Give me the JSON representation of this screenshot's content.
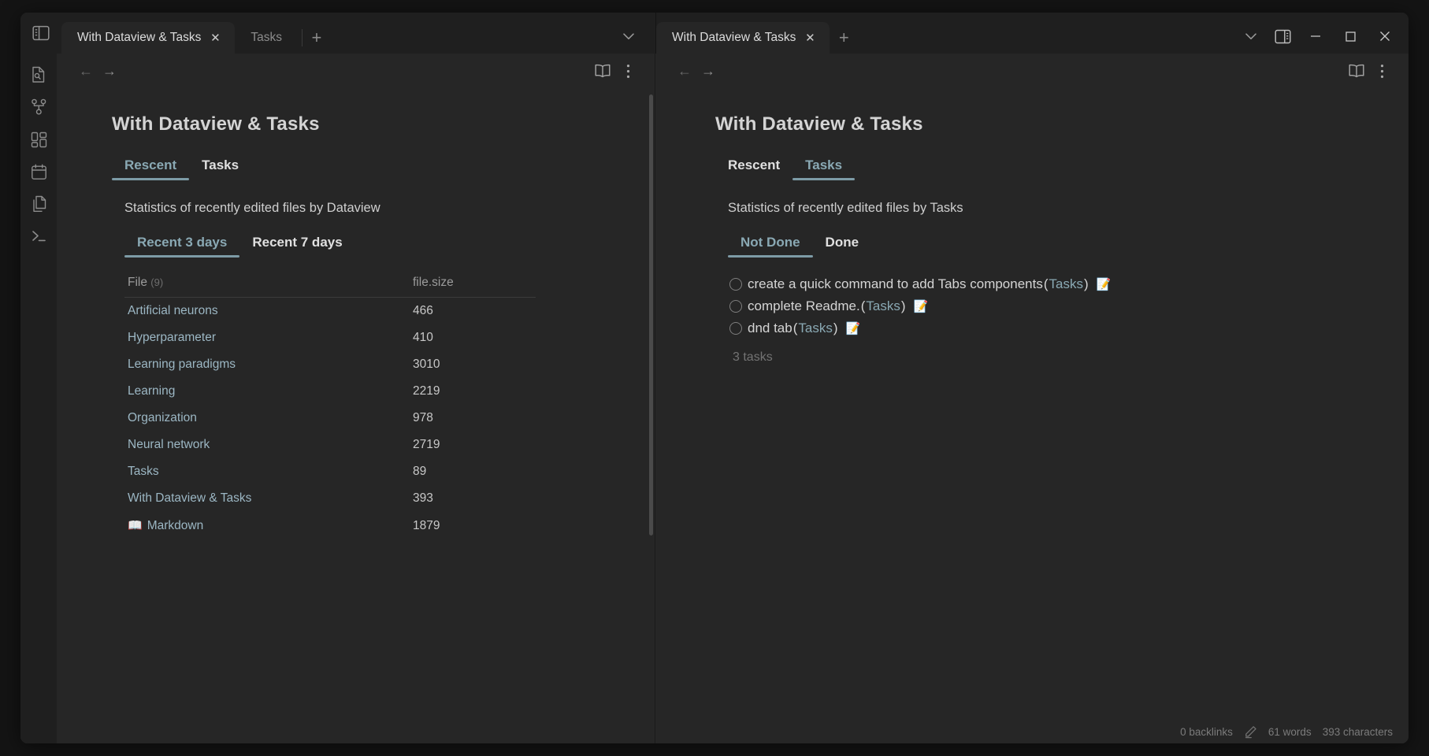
{
  "window": {
    "left_tabs": [
      {
        "label": "With Dataview & Tasks",
        "active": true,
        "close": "✕"
      },
      {
        "label": "Tasks",
        "active": false,
        "close": ""
      }
    ],
    "right_tabs": [
      {
        "label": "With Dataview & Tasks",
        "active": true,
        "close": "✕"
      }
    ],
    "new_tab_label": "+",
    "controls": {
      "minimize": "–",
      "maximize": "☐",
      "close": "✕",
      "chevron_down": "∨"
    }
  },
  "ribbon": {
    "items": [
      {
        "name": "file-search-icon"
      },
      {
        "name": "graph-view-icon"
      },
      {
        "name": "canvas-icon"
      },
      {
        "name": "calendar-icon"
      },
      {
        "name": "files-icon"
      },
      {
        "name": "terminal-icon"
      }
    ]
  },
  "left_pane": {
    "nav": {
      "back": "←",
      "forward": "→"
    },
    "title": "With Dataview & Tasks",
    "note_tabs": [
      {
        "label": "Rescent",
        "active": true
      },
      {
        "label": "Tasks",
        "active": false
      }
    ],
    "paragraph": "Statistics of recently edited files by Dataview",
    "sub_tabs": [
      {
        "label": "Recent 3 days",
        "active": true
      },
      {
        "label": "Recent 7 days",
        "active": false
      }
    ],
    "table": {
      "headers": {
        "file": "File",
        "count": "(9)",
        "size": "file.size"
      },
      "rows": [
        {
          "emoji": "",
          "file": "Artificial neurons",
          "size": "466"
        },
        {
          "emoji": "",
          "file": "Hyperparameter",
          "size": "410"
        },
        {
          "emoji": "",
          "file": "Learning paradigms",
          "size": "3010"
        },
        {
          "emoji": "",
          "file": "Learning",
          "size": "2219"
        },
        {
          "emoji": "",
          "file": "Organization",
          "size": "978"
        },
        {
          "emoji": "",
          "file": "Neural network",
          "size": "2719"
        },
        {
          "emoji": "",
          "file": "Tasks",
          "size": "89"
        },
        {
          "emoji": "",
          "file": "With Dataview & Tasks",
          "size": "393"
        },
        {
          "emoji": "📖",
          "file": "Markdown",
          "size": "1879"
        }
      ]
    }
  },
  "right_pane": {
    "nav": {
      "back": "←",
      "forward": "→"
    },
    "title": "With Dataview & Tasks",
    "note_tabs": [
      {
        "label": "Rescent",
        "active": false
      },
      {
        "label": "Tasks",
        "active": true
      }
    ],
    "paragraph": "Statistics of recently edited files by Tasks",
    "sub_tabs": [
      {
        "label": "Not Done",
        "active": true
      },
      {
        "label": "Done",
        "active": false
      }
    ],
    "tasks": [
      {
        "text": "create a quick command to add Tabs components ",
        "open_paren": "(",
        "link": "Tasks",
        "close_paren": ")",
        "emoji": "📝"
      },
      {
        "text": "complete Readme. ",
        "open_paren": "(",
        "link": "Tasks",
        "close_paren": ")",
        "emoji": "📝"
      },
      {
        "text": "dnd tab ",
        "open_paren": "(",
        "link": "Tasks",
        "close_paren": ")",
        "emoji": "📝"
      }
    ],
    "task_count": "3 tasks"
  },
  "statusbar": {
    "backlinks": "0 backlinks",
    "words": "61 words",
    "characters": "393 characters"
  },
  "colors": {
    "accent": "#8aa9b4",
    "underline": "#7d9ba6",
    "background": "#262626",
    "titlebar": "#1f1f1f"
  }
}
